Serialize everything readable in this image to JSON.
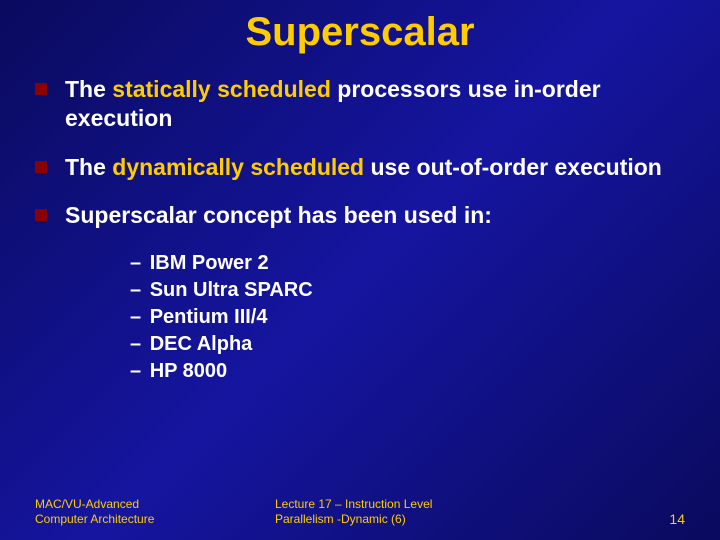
{
  "title": "Superscalar",
  "bullets": [
    {
      "pre": "The ",
      "hl": "statically scheduled",
      "post": " processors use in-order execution"
    },
    {
      "pre": "The ",
      "hl": "dynamically scheduled",
      "post": " use out-of-order execution"
    },
    {
      "pre": "Superscalar concept has been used in:",
      "hl": "",
      "post": ""
    }
  ],
  "subitems": [
    "IBM Power 2",
    "Sun Ultra SPARC",
    "Pentium III/4",
    "DEC Alpha",
    "HP 8000"
  ],
  "footer": {
    "left_line1": "MAC/VU-Advanced",
    "left_line2": "Computer Architecture",
    "center_line1": "Lecture 17 – Instruction Level",
    "center_line2": "Parallelism -Dynamic (6)",
    "page": "14"
  }
}
